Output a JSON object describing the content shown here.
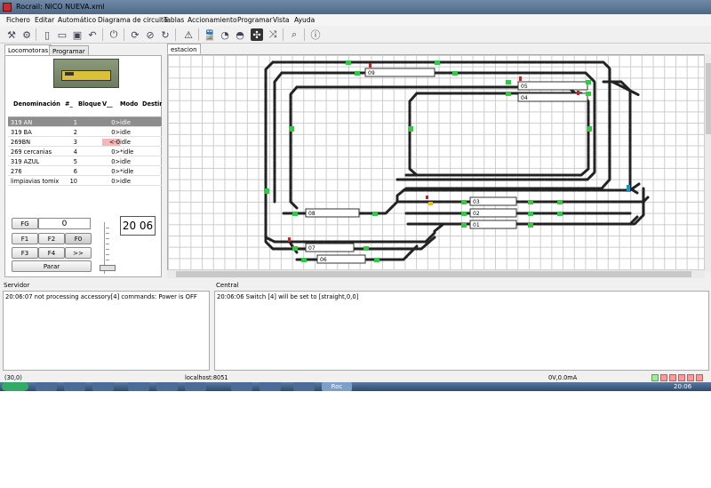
{
  "window": {
    "title": "Rocrail: NICO NUEVA.xml"
  },
  "menu": [
    "Fichero",
    "Editar",
    "Automático",
    "Diagrama de circuito",
    "Tablas",
    "Accionamiento",
    "Programar",
    "Vista",
    "Ayuda"
  ],
  "toolbar_icons": [
    "tools-icon",
    "gear-icon",
    "new-icon",
    "open-icon",
    "save-icon",
    "undo-icon",
    "power-icon",
    "auto-icon",
    "stop-icon",
    "reset-icon",
    "warning-icon",
    "train-icon",
    "timer-icon",
    "speedometer-icon",
    "network-icon",
    "shuffle-icon",
    "search-icon",
    "info-icon"
  ],
  "left_tabs": {
    "locos": "Locomotoras",
    "program": "Programar"
  },
  "plan_tab": "estacion",
  "loco_table": {
    "headers": [
      "Denominación",
      "#_",
      "Bloque",
      "V__",
      "Modo",
      "Destino"
    ],
    "rows": [
      {
        "name": "319 AN",
        "num": "1",
        "block": "",
        "v": "0>",
        "mode": "idle"
      },
      {
        "name": "319 BA",
        "num": "2",
        "block": "",
        "v": "0>",
        "mode": "idle"
      },
      {
        "name": "269BN",
        "num": "3",
        "block": "",
        "v": "<-0",
        "mode": "idle"
      },
      {
        "name": "269 cercanias",
        "num": "4",
        "block": "",
        "v": "0>",
        "mode": "*idle"
      },
      {
        "name": "319 AZUL",
        "num": "5",
        "block": "",
        "v": "0>",
        "mode": "idle"
      },
      {
        "name": "276",
        "num": "6",
        "block": "",
        "v": "0>",
        "mode": "*idle"
      },
      {
        "name": "limpiavias tomix",
        "num": "10",
        "block": "",
        "v": "0>",
        "mode": "idle"
      }
    ]
  },
  "controls": {
    "fg": "FG",
    "speed": "0",
    "f1": "F1",
    "f2": "F2",
    "f0": "F0",
    "f3": "F3",
    "f4": "F4",
    "more": ">>",
    "stop": "Parar",
    "clock": "20 06"
  },
  "blocks": [
    "09",
    "05",
    "04",
    "08",
    "03",
    "02",
    "01",
    "07",
    "06"
  ],
  "logs": {
    "server_label": "Servidor",
    "server_msg": "20:06:07 not processing accessory[4] commands: Power is OFF",
    "central_label": "Central",
    "central_msg": "20:06:06 Switch [4] will be set to [straight,0,0]"
  },
  "status": {
    "coords": "(30,0)",
    "host": "localhost:8051",
    "power": "0V,0.0mA"
  },
  "taskbar": {
    "rocrail": "Roc",
    "time": "20:06"
  },
  "colors": {
    "track": "#222222",
    "sensor": "#2ecc40",
    "signal": "#d02020",
    "selection": "#8d8d8d",
    "loco_reverse": "#f4b8b8"
  }
}
